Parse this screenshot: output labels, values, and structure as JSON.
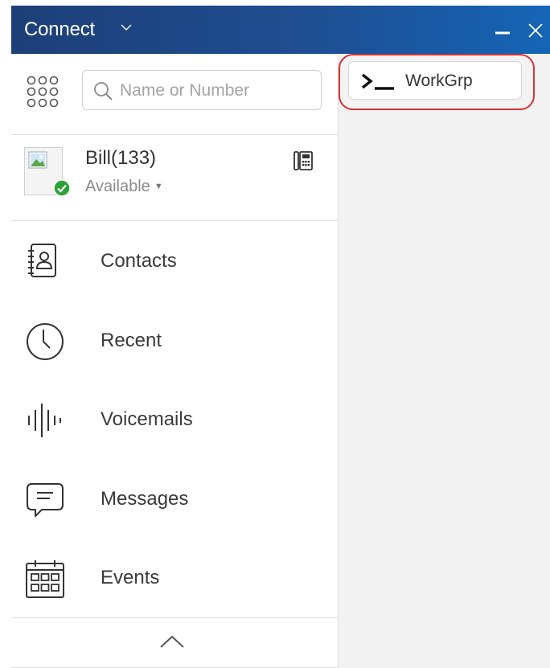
{
  "titlebar": {
    "app_title": "Connect"
  },
  "search": {
    "placeholder": "Name or Number",
    "value": ""
  },
  "user": {
    "name": "Bill(133)",
    "status": "Available",
    "status_color": "#2aa236"
  },
  "nav": {
    "items": [
      {
        "label": "Contacts",
        "icon": "contacts-book-icon"
      },
      {
        "label": "Recent",
        "icon": "clock-icon"
      },
      {
        "label": "Voicemails",
        "icon": "voicemail-waveform-icon"
      },
      {
        "label": "Messages",
        "icon": "chat-bubble-icon"
      },
      {
        "label": "Events",
        "icon": "calendar-icon"
      }
    ]
  },
  "workgroup": {
    "label": "WorkGrp",
    "icon": "terminal-icon"
  },
  "colors": {
    "titlebar_start": "#1d3f78",
    "titlebar_end": "#1565b6",
    "highlight_ring": "#d83235",
    "right_panel_bg": "#f3f3f3"
  }
}
